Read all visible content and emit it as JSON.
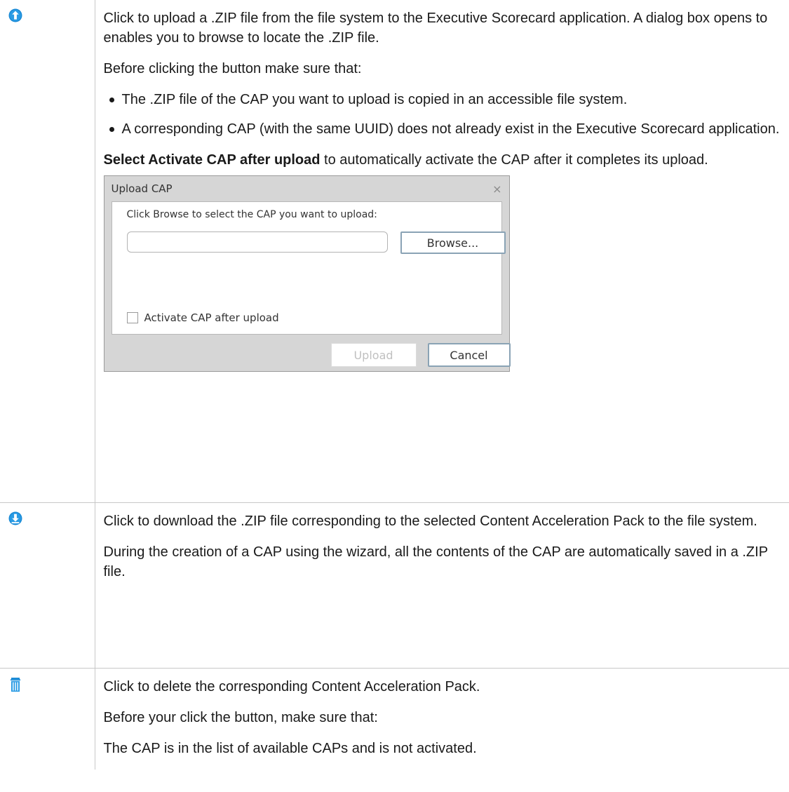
{
  "rows": [
    {
      "icon": "upload-icon",
      "paragraphs": [
        "Click to upload a .ZIP file from the file system to the Executive Scorecard application. A dialog box opens to enables you to browse to locate the .ZIP file.",
        "Before clicking the button make sure that:"
      ],
      "bullets": [
        "The .ZIP file of the CAP you want to upload is copied in an accessible file system.",
        "A corresponding CAP (with the same UUID) does not already exist in the Executive Scorecard application."
      ],
      "note_bold": "Select Activate CAP after upload",
      "note_rest": " to automatically activate the CAP after it completes its upload.",
      "dialog": {
        "title": "Upload CAP",
        "close_glyph": "×",
        "prompt": "Click Browse to select the CAP you want to upload:",
        "input_value": "",
        "browse_label": "Browse...",
        "checkbox_label": "Activate CAP after upload",
        "upload_label": "Upload",
        "cancel_label": "Cancel"
      }
    },
    {
      "icon": "download-icon",
      "paragraphs": [
        "Click to download the .ZIP file corresponding to the selected Content Acceleration Pack to the file system.",
        "During the creation of a CAP using the wizard, all the contents of the CAP are automatically saved in a .ZIP file."
      ]
    },
    {
      "icon": "trash-icon",
      "paragraphs": [
        "Click to delete the corresponding Content Acceleration Pack.",
        "Before your click the button, make sure that:",
        "The CAP is in the list of available CAPs and is not activated."
      ]
    }
  ],
  "colors": {
    "icon_blue": "#1b8bd6",
    "grid_line": "#c8c8c8",
    "dialog_frame": "#d6d6d6",
    "button_border": "#8aa3b5"
  }
}
